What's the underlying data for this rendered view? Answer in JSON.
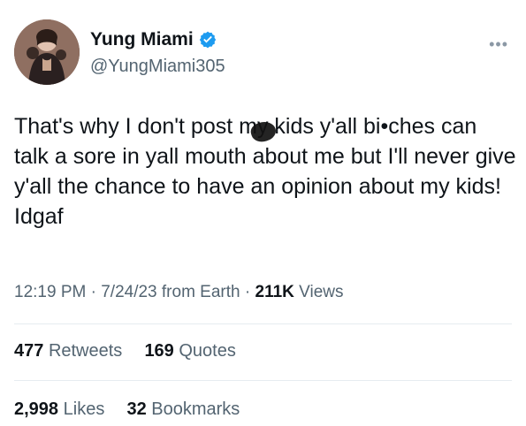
{
  "profile": {
    "name": "Yung Miami",
    "handle": "@YungMiami305",
    "verified": true,
    "avatar_icon": "profile-avatar",
    "more_icon": "more-options-icon"
  },
  "tweet": {
    "text": "That's why I don't post my kids y'all bi•ches can talk a sore in yall mouth about me but I'll never give y'all the chance to have an opinion about my kids! Idgaf"
  },
  "meta": {
    "time": "12:19 PM",
    "date": "7/24/23",
    "source": "from Earth",
    "views_count": "211K",
    "views_label": "Views"
  },
  "stats": {
    "retweets_count": "477",
    "retweets_label": "Retweets",
    "quotes_count": "169",
    "quotes_label": "Quotes",
    "likes_count": "2,998",
    "likes_label": "Likes",
    "bookmarks_count": "32",
    "bookmarks_label": "Bookmarks"
  },
  "colors": {
    "accent": "#1d9bf0",
    "muted": "#536471",
    "text": "#0f1419",
    "divider": "#e6ecf0"
  }
}
